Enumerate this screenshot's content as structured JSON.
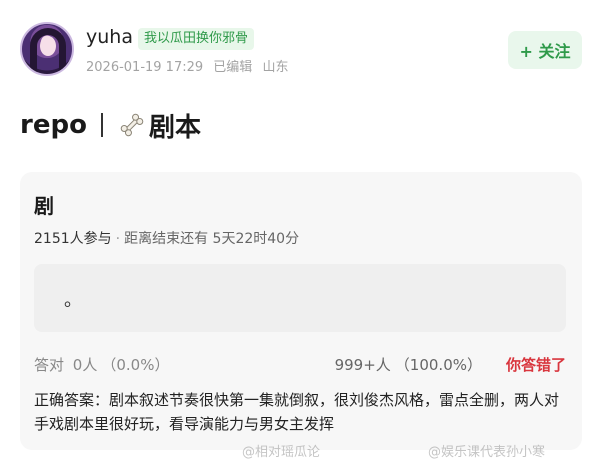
{
  "post": {
    "author": {
      "name": "yuha",
      "badge": "我以瓜田换你邪骨"
    },
    "meta": {
      "datetime": "2026-01-19 17:29",
      "edited": "已编辑",
      "location": "山东"
    },
    "follow_label": "+ 关注",
    "title": {
      "prefix": "repo",
      "topic": "剧本"
    }
  },
  "poll": {
    "question": "剧",
    "participants": "2151人参与",
    "remaining_prefix": "距离结束还有",
    "remaining_time": "5天22时40分",
    "option": "。",
    "answer_left_label": "答对",
    "answer_left_count": "0人",
    "answer_left_pct": "（0.0%）",
    "answer_right_count": "999+人",
    "answer_right_pct": "（100.0%）",
    "wrong_label": "你答错了",
    "correct_answer": "正确答案：剧本叙述节奏很快第一集就倒叙，很刘俊杰风格，雷点全删，两人对手戏剧本里很好玩，看导演能力与男女主发挥"
  },
  "watermarks": [
    "@相对瑶瓜论",
    "@娱乐课代表孙小寒"
  ],
  "icons": {
    "title_icon": "bone-icon",
    "watermark_icon": "weibo-icon"
  },
  "colors": {
    "accent_green": "#2f9a4a",
    "badge_bg": "#e8f7ea",
    "wrong_red": "#d9363e",
    "card_bg": "#f7f7f7"
  }
}
